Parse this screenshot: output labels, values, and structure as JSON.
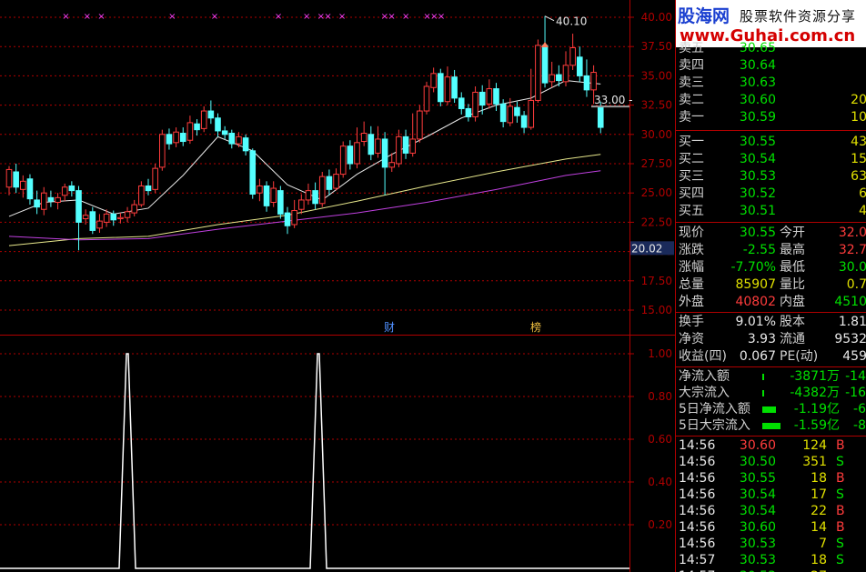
{
  "colors": {
    "up": "#ff3c3c",
    "down": "#54ffff",
    "ma_short": "#e8e8e8",
    "ma_mid": "#e8e88c",
    "ma_long": "#c040e0",
    "grid": "#b00000",
    "marker": "#ff40ff",
    "indicator": "#ffffff",
    "price_tag_bg": "#1a2a5a"
  },
  "chart_data": [
    {
      "type": "candlestick",
      "title": "",
      "y_ticks": [
        "40.00",
        "37.50",
        "35.00",
        "32.50",
        "30.00",
        "27.50",
        "25.00",
        "22.50",
        "20.00",
        "17.50",
        "15.00"
      ],
      "ylim": [
        14.0,
        40.7
      ],
      "high_label": "40.10",
      "low_label": "20.02",
      "current_price_label": "33.00",
      "event_labels": [
        {
          "text": "财",
          "bar": 41
        },
        {
          "text": "榜",
          "bar": 57
        }
      ],
      "marker_bars": [
        8,
        11,
        13,
        23,
        29,
        38,
        42,
        44,
        45,
        47,
        53,
        54,
        56,
        59,
        60,
        61
      ],
      "arrow_bar": 60,
      "candles": [
        [
          25.5,
          27.0,
          27.3,
          24.8
        ],
        [
          26.8,
          25.5,
          27.5,
          25.0
        ],
        [
          25.3,
          26.0,
          26.5,
          24.6
        ],
        [
          26.2,
          24.5,
          26.6,
          24.0
        ],
        [
          24.4,
          23.8,
          25.2,
          23.2
        ],
        [
          23.6,
          25.0,
          25.5,
          23.1
        ],
        [
          24.6,
          24.3,
          25.2,
          23.8
        ],
        [
          24.2,
          24.6,
          25.0,
          23.6
        ],
        [
          24.8,
          25.5,
          25.8,
          24.3
        ],
        [
          25.6,
          25.2,
          26.0,
          24.7
        ],
        [
          25.2,
          22.5,
          25.6,
          20.1
        ],
        [
          22.8,
          23.1,
          23.6,
          22.3
        ],
        [
          23.4,
          21.8,
          23.8,
          21.5
        ],
        [
          22.0,
          22.6,
          23.2,
          21.6
        ],
        [
          22.5,
          23.2,
          23.6,
          22.1
        ],
        [
          23.2,
          22.7,
          23.5,
          22.2
        ],
        [
          22.8,
          22.9,
          23.3,
          22.4
        ],
        [
          22.9,
          23.4,
          23.8,
          22.5
        ],
        [
          23.3,
          24.0,
          24.4,
          23.0
        ],
        [
          24.0,
          25.6,
          26.0,
          23.8
        ],
        [
          25.6,
          25.2,
          26.2,
          24.8
        ],
        [
          25.3,
          27.1,
          27.5,
          25.0
        ],
        [
          27.2,
          30.0,
          30.4,
          26.9
        ],
        [
          30.0,
          29.2,
          30.5,
          28.7
        ],
        [
          29.3,
          30.2,
          30.6,
          28.9
        ],
        [
          30.1,
          29.4,
          30.6,
          29.0
        ],
        [
          29.5,
          31.0,
          31.6,
          29.2
        ],
        [
          30.9,
          30.4,
          31.3,
          29.9
        ],
        [
          30.5,
          32.0,
          32.4,
          30.2
        ],
        [
          32.0,
          31.4,
          32.9,
          30.9
        ],
        [
          31.4,
          30.3,
          31.8,
          29.8
        ],
        [
          30.3,
          30.0,
          30.7,
          29.6
        ],
        [
          30.1,
          29.2,
          30.4,
          28.8
        ],
        [
          29.2,
          29.8,
          30.2,
          28.9
        ],
        [
          29.7,
          28.6,
          30.0,
          28.2
        ],
        [
          28.6,
          24.9,
          28.8,
          24.5
        ],
        [
          25.0,
          25.6,
          26.2,
          24.3
        ],
        [
          25.6,
          23.9,
          26.0,
          23.4
        ],
        [
          24.2,
          25.4,
          26.0,
          23.8
        ],
        [
          25.2,
          23.2,
          25.6,
          22.8
        ],
        [
          23.3,
          22.2,
          23.8,
          21.5
        ],
        [
          22.3,
          23.5,
          24.4,
          22.0
        ],
        [
          23.6,
          24.4,
          24.9,
          23.2
        ],
        [
          24.4,
          25.2,
          25.8,
          24.0
        ],
        [
          25.2,
          24.1,
          25.9,
          23.6
        ],
        [
          24.1,
          26.4,
          26.8,
          23.8
        ],
        [
          26.4,
          25.3,
          27.0,
          24.8
        ],
        [
          25.4,
          26.6,
          27.1,
          25.2
        ],
        [
          26.6,
          29.0,
          29.4,
          26.3
        ],
        [
          29.0,
          27.5,
          29.5,
          27.0
        ],
        [
          27.5,
          29.3,
          30.6,
          27.1
        ],
        [
          29.4,
          30.1,
          31.1,
          29.0
        ],
        [
          30.0,
          28.3,
          30.7,
          27.8
        ],
        [
          28.4,
          29.6,
          30.7,
          28.0
        ],
        [
          29.6,
          27.2,
          30.2,
          24.8
        ],
        [
          27.2,
          27.6,
          28.4,
          26.8
        ],
        [
          27.5,
          29.8,
          30.4,
          27.2
        ],
        [
          29.8,
          28.4,
          30.4,
          27.9
        ],
        [
          28.4,
          29.6,
          31.8,
          28.1
        ],
        [
          29.6,
          32.0,
          32.5,
          29.3
        ],
        [
          32.0,
          34.1,
          34.5,
          31.7
        ],
        [
          34.0,
          35.2,
          35.7,
          33.6
        ],
        [
          35.2,
          32.8,
          35.6,
          32.4
        ],
        [
          32.8,
          34.9,
          35.8,
          32.5
        ],
        [
          34.9,
          33.1,
          35.5,
          32.7
        ],
        [
          33.1,
          32.2,
          33.6,
          31.7
        ],
        [
          32.2,
          31.5,
          32.6,
          31.1
        ],
        [
          31.5,
          33.6,
          34.1,
          31.1
        ],
        [
          33.6,
          32.5,
          34.2,
          31.7
        ],
        [
          32.6,
          33.9,
          34.7,
          32.2
        ],
        [
          33.9,
          32.6,
          34.4,
          32.0
        ],
        [
          32.6,
          31.1,
          33.0,
          30.6
        ],
        [
          31.0,
          32.4,
          33.1,
          30.7
        ],
        [
          32.3,
          31.6,
          32.8,
          31.0
        ],
        [
          31.6,
          30.6,
          32.0,
          30.1
        ],
        [
          30.6,
          32.9,
          35.6,
          30.4
        ],
        [
          32.9,
          37.6,
          38.1,
          32.7
        ],
        [
          37.6,
          34.4,
          40.1,
          34.0
        ],
        [
          34.5,
          35.1,
          36.2,
          34.0
        ],
        [
          35.1,
          34.6,
          35.9,
          34.1
        ],
        [
          34.5,
          35.9,
          37.1,
          34.1
        ],
        [
          35.9,
          37.4,
          38.6,
          35.5
        ],
        [
          36.6,
          35.0,
          37.5,
          34.5
        ],
        [
          35.0,
          33.8,
          36.4,
          33.2
        ],
        [
          33.8,
          35.3,
          35.9,
          32.6
        ],
        [
          32.3,
          30.6,
          32.8,
          30.1
        ]
      ],
      "moving_averages": [
        {
          "name": "",
          "color": "#e8e8e8",
          "values": [
            [
              0,
              23.0
            ],
            [
              5,
              24.2
            ],
            [
              10,
              24.4
            ],
            [
              15,
              23.2
            ],
            [
              20,
              23.7
            ],
            [
              25,
              26.5
            ],
            [
              30,
              29.8
            ],
            [
              35,
              28.6
            ],
            [
              40,
              25.7
            ],
            [
              45,
              24.4
            ],
            [
              50,
              26.6
            ],
            [
              55,
              28.3
            ],
            [
              60,
              29.8
            ],
            [
              65,
              31.4
            ],
            [
              70,
              32.5
            ],
            [
              75,
              33.1
            ],
            [
              80,
              34.6
            ],
            [
              85,
              34.3
            ]
          ]
        },
        {
          "name": "",
          "color": "#e8e88c",
          "values": [
            [
              0,
              20.5
            ],
            [
              10,
              21.1
            ],
            [
              20,
              21.3
            ],
            [
              30,
              22.3
            ],
            [
              40,
              23.1
            ],
            [
              50,
              24.3
            ],
            [
              60,
              25.6
            ],
            [
              70,
              26.8
            ],
            [
              80,
              27.9
            ],
            [
              85,
              28.3
            ]
          ]
        },
        {
          "name": "",
          "color": "#c040e0",
          "values": [
            [
              0,
              21.3
            ],
            [
              10,
              21.0
            ],
            [
              20,
              21.1
            ],
            [
              30,
              21.9
            ],
            [
              40,
              22.6
            ],
            [
              50,
              23.3
            ],
            [
              60,
              24.2
            ],
            [
              70,
              25.3
            ],
            [
              80,
              26.5
            ],
            [
              85,
              26.9
            ]
          ]
        }
      ]
    },
    {
      "type": "line",
      "title": "",
      "y_ticks": [
        "1.00",
        "0.80",
        "0.60",
        "0.40",
        "0.20"
      ],
      "ylim": [
        0,
        1.06
      ],
      "signal_bars": [
        17,
        44
      ],
      "values_note_free": true
    }
  ],
  "panel": {
    "logo": {
      "brand": "股海网",
      "slogan": "股票软件资源分享",
      "url": "www.Guhai.com.cn"
    },
    "order_book": {
      "sell": [
        {
          "label": "卖五",
          "price": "30.65",
          "vol": ""
        },
        {
          "label": "卖四",
          "price": "30.64",
          "vol": ""
        },
        {
          "label": "卖三",
          "price": "30.63",
          "vol": ""
        },
        {
          "label": "卖二",
          "price": "30.60",
          "vol": "20"
        },
        {
          "label": "卖一",
          "price": "30.59",
          "vol": "10"
        }
      ],
      "buy": [
        {
          "label": "买一",
          "price": "30.55",
          "vol": "43"
        },
        {
          "label": "买二",
          "price": "30.54",
          "vol": "15"
        },
        {
          "label": "买三",
          "price": "30.53",
          "vol": "63"
        },
        {
          "label": "买四",
          "price": "30.52",
          "vol": "6"
        },
        {
          "label": "买五",
          "price": "30.51",
          "vol": "4"
        }
      ]
    },
    "quote": [
      {
        "l1": "现价",
        "v1": "30.55",
        "c1": "grn",
        "l2": "今开",
        "v2": "32.0",
        "c2": "red"
      },
      {
        "l1": "涨跌",
        "v1": "-2.55",
        "c1": "grn",
        "l2": "最高",
        "v2": "32.7",
        "c2": "red"
      },
      {
        "l1": "涨幅",
        "v1": "-7.70%",
        "c1": "grn",
        "l2": "最低",
        "v2": "30.0",
        "c2": "grn"
      },
      {
        "l1": "总量",
        "v1": "85907",
        "c1": "yel",
        "l2": "量比",
        "v2": "0.7",
        "c2": "yel"
      },
      {
        "l1": "外盘",
        "v1": "40802",
        "c1": "red",
        "l2": "内盘",
        "v2": "4510",
        "c2": "grn"
      }
    ],
    "fundamentals": [
      {
        "l1": "换手",
        "v1": "9.01%",
        "l2": "股本",
        "v2": "1.81"
      },
      {
        "l1": "净资",
        "v1": "3.93",
        "l2": "流通",
        "v2": "9532"
      },
      {
        "l1": "收益(四)",
        "v1": "0.067",
        "l2": "PE(动)",
        "v2": "459"
      }
    ],
    "flows": [
      {
        "label": "净流入额",
        "value": "-3871万",
        "extra": "-14",
        "bar": 0.08
      },
      {
        "label": "大宗流入",
        "value": "-4382万",
        "extra": "-16",
        "bar": 0.08
      },
      {
        "label": "5日净流入额",
        "value": "-1.19亿",
        "extra": "-6",
        "bar": 0.6
      },
      {
        "label": "5日大宗流入",
        "value": "-1.59亿",
        "extra": "-8",
        "bar": 0.8
      }
    ],
    "ticks": [
      {
        "time": "14:56",
        "price": "30.60",
        "vol": "124",
        "side": "B",
        "pc": "red"
      },
      {
        "time": "14:56",
        "price": "30.50",
        "vol": "351",
        "side": "S",
        "pc": "grn"
      },
      {
        "time": "14:56",
        "price": "30.55",
        "vol": "18",
        "side": "B",
        "pc": "grn"
      },
      {
        "time": "14:56",
        "price": "30.54",
        "vol": "17",
        "side": "S",
        "pc": "grn"
      },
      {
        "time": "14:56",
        "price": "30.54",
        "vol": "22",
        "side": "B",
        "pc": "grn"
      },
      {
        "time": "14:56",
        "price": "30.60",
        "vol": "14",
        "side": "B",
        "pc": "grn"
      },
      {
        "time": "14:56",
        "price": "30.53",
        "vol": "7",
        "side": "S",
        "pc": "grn"
      },
      {
        "time": "14:57",
        "price": "30.53",
        "vol": "18",
        "side": "S",
        "pc": "grn"
      },
      {
        "time": "14:57",
        "price": "30.53",
        "vol": "27",
        "side": "",
        "pc": "grn"
      }
    ]
  }
}
